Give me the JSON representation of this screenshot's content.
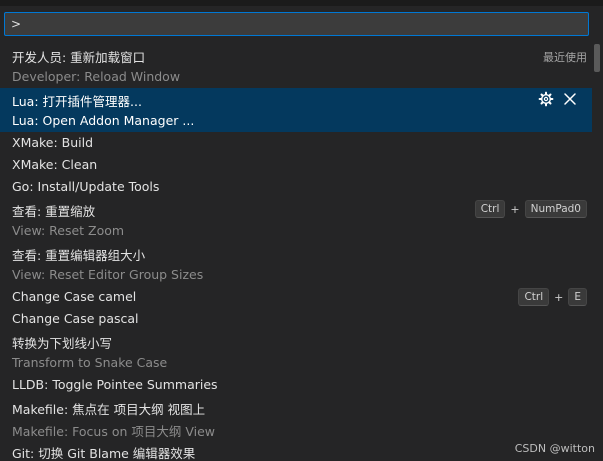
{
  "background_text": "",
  "search": {
    "value": ">"
  },
  "items": [
    {
      "label": "开发人员: 重新加载窗口",
      "detail": "Developer: Reload Window",
      "aside": "最近使用"
    },
    {
      "label": "Lua: 打开插件管理器...",
      "detail": "Lua: Open Addon Manager ...",
      "selected": true
    },
    {
      "label": "XMake: Build"
    },
    {
      "label": "XMake: Clean"
    },
    {
      "label": "Go: Install/Update Tools"
    },
    {
      "label": "查看: 重置缩放",
      "detail": "View: Reset Zoom",
      "keys": [
        "Ctrl",
        "NumPad0"
      ]
    },
    {
      "label": "查看: 重置编辑器组大小",
      "detail": "View: Reset Editor Group Sizes"
    },
    {
      "label": "Change Case camel",
      "keys": [
        "Ctrl",
        "E"
      ]
    },
    {
      "label": "Change Case pascal"
    },
    {
      "label": "转换为下划线小写",
      "detail": "Transform to Snake Case"
    },
    {
      "label": "LLDB: Toggle Pointee Summaries"
    },
    {
      "label": "Makefile: 焦点在 项目大纲 视图上",
      "detail": "Makefile: Focus on 项目大纲 View"
    },
    {
      "label": "Git: 切换 Git Blame 编辑器效果"
    }
  ],
  "key_separator": "+",
  "icons": {
    "settings": "gear-icon",
    "close": "close-icon"
  },
  "colors": {
    "selection": "#04395e",
    "focus_border": "#0078d4",
    "background": "#252526"
  },
  "watermark": "CSDN @witton"
}
